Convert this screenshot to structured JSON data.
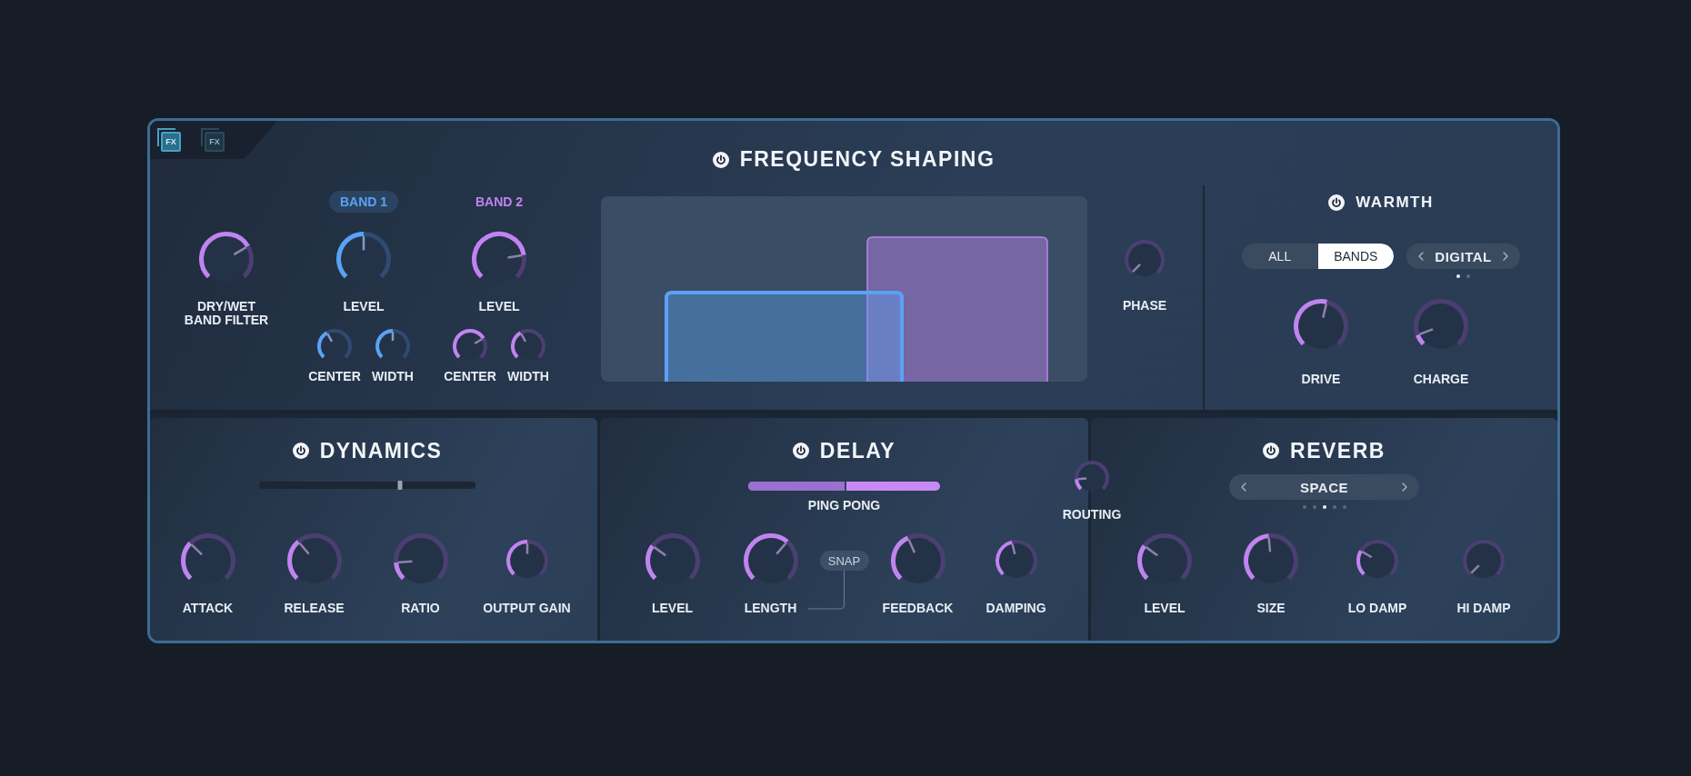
{
  "fx_tabs": [
    {
      "label": "FX",
      "selected": true
    },
    {
      "label": "FX",
      "selected": false
    }
  ],
  "frequency_shaping": {
    "title": "FREQUENCY SHAPING",
    "dry_wet": {
      "label": "DRY/WET BAND FILTER"
    },
    "bands": [
      {
        "label": "BAND 1",
        "selected": true,
        "color": "#5aa2f5",
        "level_knob": {
          "label": "LEVEL"
        },
        "knobs": [
          {
            "label": "CENTER"
          },
          {
            "label": "WIDTH"
          }
        ]
      },
      {
        "label": "BAND 2",
        "selected": false,
        "color": "#c084f0",
        "level_knob": {
          "label": "LEVEL"
        },
        "knobs": [
          {
            "label": "CENTER"
          },
          {
            "label": "WIDTH"
          }
        ]
      }
    ],
    "phase": {
      "label": "PHASE"
    }
  },
  "warmth": {
    "title": "WARMTH",
    "modes": [
      {
        "label": "ALL",
        "selected": false
      },
      {
        "label": "BANDS",
        "selected": true
      }
    ],
    "selector": {
      "value": "DIGITAL",
      "pages": [
        {
          "selected": true
        },
        {
          "selected": false
        }
      ]
    },
    "knobs": [
      {
        "label": "DRIVE"
      },
      {
        "label": "CHARGE"
      }
    ]
  },
  "dynamics": {
    "title": "DYNAMICS",
    "slider": {
      "level": 0.65
    },
    "knobs": [
      {
        "label": "ATTACK",
        "kind": "large"
      },
      {
        "label": "RELEASE",
        "kind": "large"
      },
      {
        "label": "RATIO",
        "kind": "large"
      },
      {
        "label": "OUTPUT GAIN",
        "kind": "small"
      }
    ]
  },
  "delay": {
    "title": "DELAY",
    "ping_pong": {
      "label": "PING PONG",
      "level": 0.5
    },
    "snap": {
      "label": "SNAP"
    },
    "knobs": [
      {
        "label": "LEVEL",
        "kind": "large"
      },
      {
        "label": "LENGTH",
        "kind": "large"
      },
      {
        "label": "FEEDBACK",
        "kind": "large"
      },
      {
        "label": "DAMPING",
        "kind": "small"
      }
    ]
  },
  "routing": {
    "label": "ROUTING"
  },
  "reverb": {
    "title": "REVERB",
    "selector": {
      "value": "SPACE",
      "pages": [
        {
          "selected": false
        },
        {
          "selected": false
        },
        {
          "selected": true
        },
        {
          "selected": false
        },
        {
          "selected": false
        }
      ]
    },
    "knobs": [
      {
        "label": "LEVEL",
        "kind": "large"
      },
      {
        "label": "SIZE",
        "kind": "large"
      },
      {
        "label": "LO DAMP",
        "kind": "small"
      },
      {
        "label": "HI DAMP",
        "kind": "small"
      }
    ]
  }
}
